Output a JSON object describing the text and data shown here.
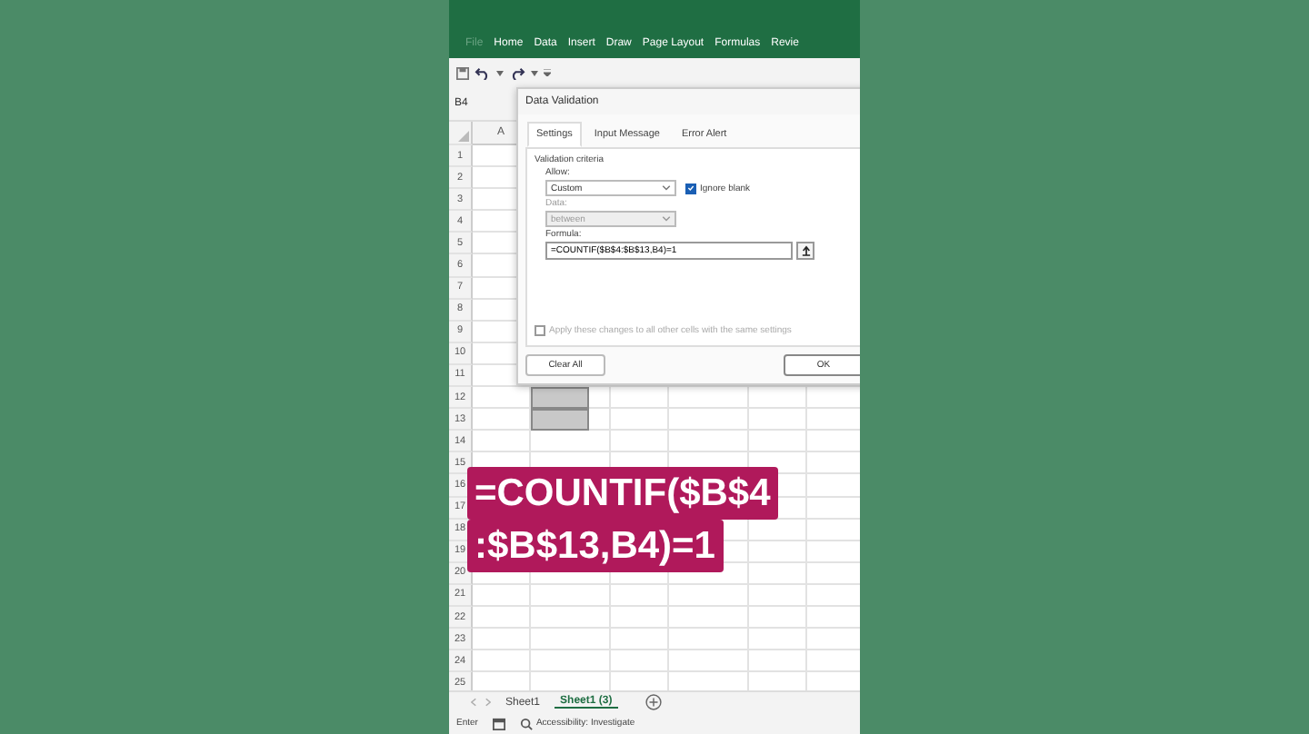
{
  "ribbon": {
    "tabs": [
      {
        "label": "File",
        "selected": false,
        "faded": true
      },
      {
        "label": "Home",
        "selected": false,
        "faded": false
      },
      {
        "label": "Data",
        "selected": false,
        "faded": false
      },
      {
        "label": "Insert",
        "selected": false,
        "faded": false
      },
      {
        "label": "Draw",
        "selected": false,
        "faded": false
      },
      {
        "label": "Page Layout",
        "selected": false,
        "faded": false
      },
      {
        "label": "Formulas",
        "selected": false,
        "faded": false
      },
      {
        "label": "Revie",
        "selected": false,
        "faded": false
      }
    ]
  },
  "name_box": {
    "value": "B4"
  },
  "columns": [
    "A"
  ],
  "rows": [
    {
      "label": "1"
    },
    {
      "label": "2"
    },
    {
      "label": "3"
    },
    {
      "label": "4"
    },
    {
      "label": "5"
    },
    {
      "label": "6"
    },
    {
      "label": "7"
    },
    {
      "label": "8"
    },
    {
      "label": "9"
    },
    {
      "label": "10"
    },
    {
      "label": "11",
      "selected": false
    },
    {
      "label": "12",
      "selected": true
    },
    {
      "label": "13",
      "selected": true
    },
    {
      "label": "14",
      "selected": false
    },
    {
      "label": "15",
      "selected": false
    },
    {
      "label": "16"
    },
    {
      "label": "17"
    },
    {
      "label": "18"
    },
    {
      "label": "19"
    },
    {
      "label": "20",
      "selected": false
    },
    {
      "label": "21",
      "selected": false
    },
    {
      "label": "22",
      "selected": false
    },
    {
      "label": "23",
      "selected": false
    },
    {
      "label": "24",
      "selected": false
    },
    {
      "label": "25",
      "selected": false
    }
  ],
  "dialog": {
    "title": "Data Validation",
    "tabs": [
      {
        "label": "Settings",
        "selected": true
      },
      {
        "label": "Input Message",
        "selected": false
      },
      {
        "label": "Error Alert",
        "selected": false
      }
    ],
    "group_label": "Validation criteria",
    "allow_label": "Allow:",
    "allow_value": "Custom",
    "ignore_blank": {
      "label": "Ignore blank",
      "checked": true
    },
    "data_label": "Data:",
    "data_value": "between",
    "data_disabled": true,
    "formula_label": "Formula:",
    "formula_value": "=COUNTIF($B$4:$B$13,B4)=1",
    "apply_all": {
      "label": "Apply these changes to all other cells with the same settings",
      "checked": false,
      "disabled": true
    },
    "clear_button": "Clear All",
    "ok_button": "OK"
  },
  "caption": {
    "lines": [
      "=COUNTIF($B$4",
      ":$B$13,B4)=1"
    ]
  },
  "sheet_tabs": [
    {
      "label": "Sheet1",
      "selected": false
    },
    {
      "label": "Sheet1 (3)",
      "selected": true
    }
  ],
  "status_bar": {
    "mode": "Enter",
    "accessibility": "Accessibility: Investigate"
  }
}
